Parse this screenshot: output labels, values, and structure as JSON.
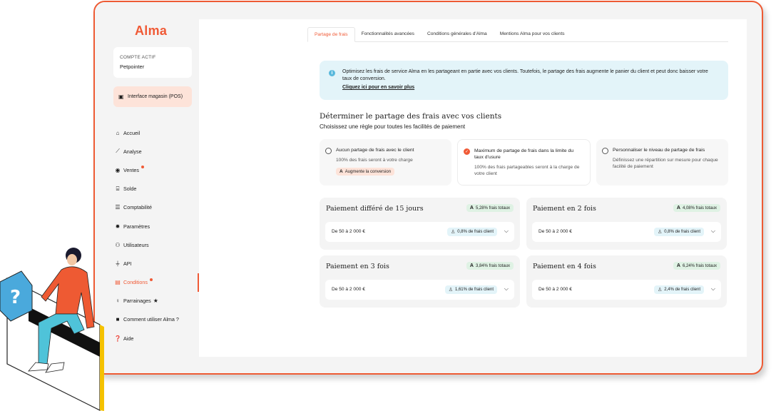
{
  "sidebar": {
    "logo": "Alma",
    "account_label": "COMPTE ACTIF",
    "account_name": "Petpointer",
    "pos_label": "Interface magasin (POS)",
    "items": [
      {
        "label": "Accueil",
        "icon": "home-icon"
      },
      {
        "label": "Analyse",
        "icon": "chart-icon"
      },
      {
        "label": "Ventes",
        "icon": "eye-icon"
      },
      {
        "label": "Solde",
        "icon": "bank-icon"
      },
      {
        "label": "Comptabilité",
        "icon": "database-icon"
      },
      {
        "label": "Paramètres",
        "icon": "gear-icon"
      },
      {
        "label": "Utilisateurs",
        "icon": "users-icon"
      },
      {
        "label": "API",
        "icon": "plug-icon"
      },
      {
        "label": "Conditions",
        "icon": "document-icon"
      },
      {
        "label": "Parrainages",
        "icon": "referral-icon"
      },
      {
        "label": "Comment utiliser Alma ?",
        "icon": "video-icon"
      },
      {
        "label": "Aide",
        "icon": "help-icon"
      }
    ]
  },
  "tabs": [
    "Partage de frais",
    "Fonctionnalités avancées",
    "Conditions générales d'Alma",
    "Mentions Alma pour vos clients"
  ],
  "info": {
    "text": "Optimisez les frais de service Alma en les partageant en partie avec vos clients. Toutefois, le partage des frais augmente le panier du client et peut donc baisser votre taux de conversion.",
    "link": "Cliquez ici pour en savoir plus"
  },
  "section": {
    "title": "Déterminer le partage des frais avec vos clients",
    "subtitle": "Choisissez une règle pour toutes les facilités de paiement"
  },
  "options": [
    {
      "title": "Aucun partage de frais avec le client",
      "desc": "100% des frais seront à votre charge",
      "badge": "Augmente la conversion"
    },
    {
      "title": "Maximum de partage de frais dans la limite du taux d'usure",
      "desc": "100% des frais partageables seront à la charge de votre client"
    },
    {
      "title": "Personnaliser le niveau de partage de frais",
      "desc": "Définissez une répartition sur mesure pour chaque facilité de paiement"
    }
  ],
  "payments": [
    {
      "title": "Paiement différé de 15 jours",
      "total": "5,28% frais totaux",
      "range": "De 50 à 2 000 €",
      "client": "0,8% de frais client"
    },
    {
      "title": "Paiement en 2 fois",
      "total": "4,08% frais totaux",
      "range": "De 50 à 2 000 €",
      "client": "0,8% de frais client"
    },
    {
      "title": "Paiement en 3 fois",
      "total": "3,84% frais totaux",
      "range": "De 50 à 2 000 €",
      "client": "1,61% de frais client"
    },
    {
      "title": "Paiement en 4 fois",
      "total": "6,24% frais totaux",
      "range": "De 50 à 2 000 €",
      "client": "2,4% de frais client"
    }
  ],
  "colors": {
    "accent": "#f05a36",
    "info_bg": "#e3f4f9",
    "fee_bg": "#dff2e4"
  }
}
